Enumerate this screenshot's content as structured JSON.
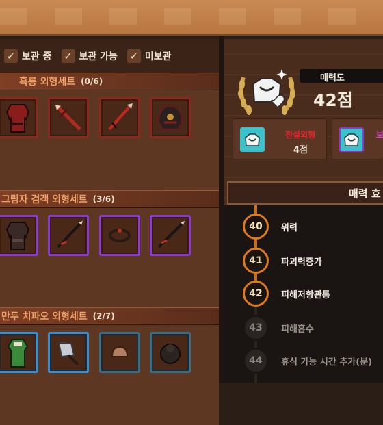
{
  "filters": [
    {
      "label": "보관 중",
      "checked": true
    },
    {
      "label": "보관 가능",
      "checked": true
    },
    {
      "label": "미보관",
      "checked": true
    }
  ],
  "sets": [
    {
      "title": "흑룡 외형세트",
      "count": "(0/6)"
    },
    {
      "title": "그림자 검객 외형세트",
      "count": "(3/6)"
    },
    {
      "title": "만두 치파오 외형세트",
      "count": "(2/7)"
    }
  ],
  "charm": {
    "title": "매력도",
    "score": "42점"
  },
  "cards": [
    {
      "label": "전설외형",
      "value": "4점"
    },
    {
      "label": "보",
      "value": ""
    }
  ],
  "effects_header": "매력 효",
  "effects": [
    {
      "level": "40",
      "name": "위력",
      "active": true
    },
    {
      "level": "41",
      "name": "파괴력증가",
      "active": true
    },
    {
      "level": "42",
      "name": "피해저항관통",
      "active": true
    },
    {
      "level": "43",
      "name": "피해흡수",
      "active": false
    },
    {
      "level": "44",
      "name": "휴식 가능 시간 추가(분)",
      "active": false
    }
  ],
  "colors": {
    "legend_border": "#8a2a1e",
    "epic_border": "#8b3ad6",
    "rare_border": "#3a8fd0",
    "active_ring": "#e07a1a"
  }
}
